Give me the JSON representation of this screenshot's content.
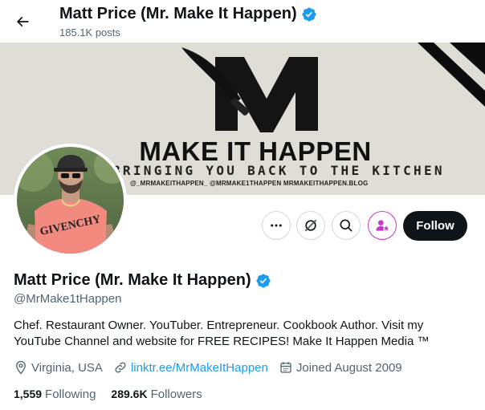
{
  "header": {
    "name": "Matt Price (Mr. Make It Happen)",
    "posts": "185.1K posts"
  },
  "banner": {
    "line1": "MAKE IT HAPPEN",
    "line2": "BRINGING YOU BACK TO THE KITCHEN",
    "line3": "@_MRMAKEITHAPPEN_  @MRMAKE1THAPPEN  MRMAKEITHAPPEN.BLOG",
    "monogram": "M"
  },
  "profile": {
    "name": "Matt Price (Mr. Make It Happen)",
    "handle": "@MrMake1tHappen",
    "bio": "Chef. Restaurant Owner. YouTuber. Entrepreneur. Cookbook Author. Visit my YouTube Channel and website for FREE RECIPES! Make It Happen Media ™",
    "location": "Virginia, USA",
    "website": "linktr.ee/MrMakeItHappen",
    "joined": "Joined August 2009",
    "following_count": "1,559",
    "following_label": "Following",
    "followers_count": "289.6K",
    "followers_label": "Followers",
    "shirt_text": "GIVENCHY"
  },
  "actions": {
    "follow_label": "Follow",
    "more_icon": "more-icon",
    "grok_icon": "grok-icon",
    "search_icon": "search-icon",
    "subscribe_icon": "subscribe-icon"
  },
  "colors": {
    "verified": "#1d9bf0",
    "link": "#1d9bf0",
    "subscribe": "#c936cc",
    "follow_bg": "#0f1419"
  }
}
